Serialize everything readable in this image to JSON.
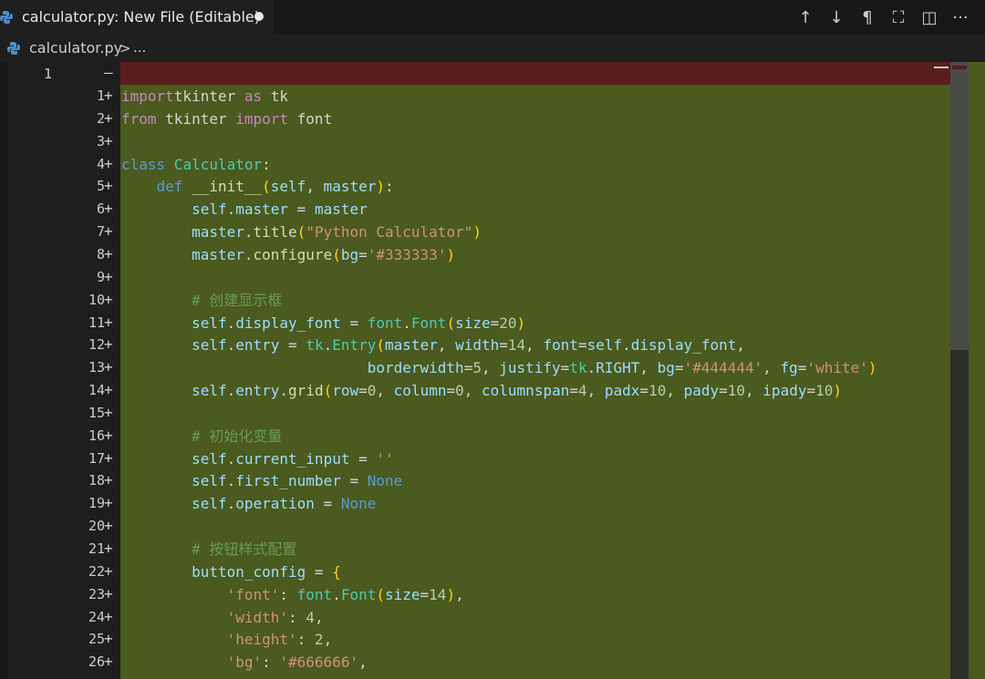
{
  "tab": {
    "title": "calculator.py: New File (Editable)",
    "python_icon": "python-icon",
    "modified_dot": "modified-dot-icon"
  },
  "actions": [
    {
      "name": "arrow-up-icon",
      "glyph": "↑"
    },
    {
      "name": "arrow-down-icon",
      "glyph": "↓"
    },
    {
      "name": "pilcrow-icon",
      "glyph": "¶"
    },
    {
      "name": "map-icon",
      "glyph": "⛶"
    },
    {
      "name": "split-editor-icon",
      "glyph": "◫"
    },
    {
      "name": "more-icon",
      "glyph": "···"
    }
  ],
  "breadcrumb": {
    "file": "calculator.py",
    "separator": ">",
    "more": "..."
  },
  "diff": {
    "original_line_number": "1",
    "original_marker": "—",
    "added_marker": "+"
  },
  "code": [
    {
      "num": "1",
      "segments": [
        [
          "kw",
          "import"
        ],
        [
          "",
          "tkinter"
        ],
        [
          "kw",
          " as"
        ],
        [
          "",
          " tk"
        ]
      ]
    },
    {
      "num": "2",
      "segments": [
        [
          "kw",
          "from"
        ],
        [
          "",
          " tkinter "
        ],
        [
          "kw",
          "import"
        ],
        [
          "",
          " font"
        ]
      ]
    },
    {
      "num": "3",
      "segments": []
    },
    {
      "num": "4",
      "segments": [
        [
          "def",
          "class"
        ],
        [
          "cls",
          " Calculator"
        ],
        [
          "",
          ":"
        ]
      ]
    },
    {
      "num": "5",
      "segments": [
        [
          "",
          "    "
        ],
        [
          "def",
          "def"
        ],
        [
          "fn",
          " __init__"
        ],
        [
          "brace",
          "("
        ],
        [
          "var",
          "self"
        ],
        [
          "",
          ", "
        ],
        [
          "var",
          "master"
        ],
        [
          "brace",
          ")"
        ],
        [
          "",
          ":"
        ]
      ]
    },
    {
      "num": "6",
      "segments": [
        [
          "",
          "        "
        ],
        [
          "var",
          "self"
        ],
        [
          "",
          "."
        ],
        [
          "var",
          "master"
        ],
        [
          "",
          " = "
        ],
        [
          "var",
          "master"
        ]
      ]
    },
    {
      "num": "7",
      "segments": [
        [
          "",
          "        "
        ],
        [
          "var",
          "master"
        ],
        [
          "",
          "."
        ],
        [
          "fn",
          "title"
        ],
        [
          "brace",
          "("
        ],
        [
          "str",
          "\"Python Calculator\""
        ],
        [
          "brace",
          ")"
        ]
      ]
    },
    {
      "num": "8",
      "segments": [
        [
          "",
          "        "
        ],
        [
          "var",
          "master"
        ],
        [
          "",
          "."
        ],
        [
          "fn",
          "configure"
        ],
        [
          "brace",
          "("
        ],
        [
          "var",
          "bg"
        ],
        [
          "",
          "="
        ],
        [
          "str",
          "'#333333'"
        ],
        [
          "brace",
          ")"
        ]
      ]
    },
    {
      "num": "9",
      "segments": []
    },
    {
      "num": "10",
      "segments": [
        [
          "",
          "        "
        ],
        [
          "cmt",
          "# 创建显示框"
        ]
      ]
    },
    {
      "num": "11",
      "segments": [
        [
          "",
          "        "
        ],
        [
          "var",
          "self"
        ],
        [
          "",
          "."
        ],
        [
          "var",
          "display_font"
        ],
        [
          "",
          " = "
        ],
        [
          "cls",
          "font"
        ],
        [
          "",
          "."
        ],
        [
          "cls",
          "Font"
        ],
        [
          "brace",
          "("
        ],
        [
          "var",
          "size"
        ],
        [
          "",
          "="
        ],
        [
          "num",
          "20"
        ],
        [
          "brace",
          ")"
        ]
      ]
    },
    {
      "num": "12",
      "segments": [
        [
          "",
          "        "
        ],
        [
          "var",
          "self"
        ],
        [
          "",
          "."
        ],
        [
          "var",
          "entry"
        ],
        [
          "",
          " = "
        ],
        [
          "cls",
          "tk"
        ],
        [
          "",
          "."
        ],
        [
          "cls",
          "Entry"
        ],
        [
          "brace",
          "("
        ],
        [
          "var",
          "master"
        ],
        [
          "",
          ", "
        ],
        [
          "var",
          "width"
        ],
        [
          "",
          "="
        ],
        [
          "num",
          "14"
        ],
        [
          "",
          ", "
        ],
        [
          "var",
          "font"
        ],
        [
          "",
          "="
        ],
        [
          "var",
          "self"
        ],
        [
          "",
          "."
        ],
        [
          "var",
          "display_font"
        ],
        [
          "",
          ","
        ]
      ]
    },
    {
      "num": "13",
      "segments": [
        [
          "",
          "                            "
        ],
        [
          "var",
          "borderwidth"
        ],
        [
          "",
          "="
        ],
        [
          "num",
          "5"
        ],
        [
          "",
          ", "
        ],
        [
          "var",
          "justify"
        ],
        [
          "",
          "="
        ],
        [
          "cls",
          "tk"
        ],
        [
          "",
          "."
        ],
        [
          "var",
          "RIGHT"
        ],
        [
          "",
          ", "
        ],
        [
          "var",
          "bg"
        ],
        [
          "",
          "="
        ],
        [
          "str",
          "'#444444'"
        ],
        [
          "",
          ", "
        ],
        [
          "var",
          "fg"
        ],
        [
          "",
          "="
        ],
        [
          "str",
          "'white'"
        ],
        [
          "brace",
          ")"
        ]
      ]
    },
    {
      "num": "14",
      "segments": [
        [
          "",
          "        "
        ],
        [
          "var",
          "self"
        ],
        [
          "",
          "."
        ],
        [
          "var",
          "entry"
        ],
        [
          "",
          "."
        ],
        [
          "fn",
          "grid"
        ],
        [
          "brace",
          "("
        ],
        [
          "var",
          "row"
        ],
        [
          "",
          "="
        ],
        [
          "num",
          "0"
        ],
        [
          "",
          ", "
        ],
        [
          "var",
          "column"
        ],
        [
          "",
          "="
        ],
        [
          "num",
          "0"
        ],
        [
          "",
          ", "
        ],
        [
          "var",
          "columnspan"
        ],
        [
          "",
          "="
        ],
        [
          "num",
          "4"
        ],
        [
          "",
          ", "
        ],
        [
          "var",
          "padx"
        ],
        [
          "",
          "="
        ],
        [
          "num",
          "10"
        ],
        [
          "",
          ", "
        ],
        [
          "var",
          "pady"
        ],
        [
          "",
          "="
        ],
        [
          "num",
          "10"
        ],
        [
          "",
          ", "
        ],
        [
          "var",
          "ipady"
        ],
        [
          "",
          "="
        ],
        [
          "num",
          "10"
        ],
        [
          "brace",
          ")"
        ]
      ]
    },
    {
      "num": "15",
      "segments": []
    },
    {
      "num": "16",
      "segments": [
        [
          "",
          "        "
        ],
        [
          "cmt",
          "# 初始化变量"
        ]
      ]
    },
    {
      "num": "17",
      "segments": [
        [
          "",
          "        "
        ],
        [
          "var",
          "self"
        ],
        [
          "",
          "."
        ],
        [
          "var",
          "current_input"
        ],
        [
          "",
          " = "
        ],
        [
          "str",
          "''"
        ]
      ]
    },
    {
      "num": "18",
      "segments": [
        [
          "",
          "        "
        ],
        [
          "var",
          "self"
        ],
        [
          "",
          "."
        ],
        [
          "var",
          "first_number"
        ],
        [
          "",
          " = "
        ],
        [
          "def",
          "None"
        ]
      ]
    },
    {
      "num": "19",
      "segments": [
        [
          "",
          "        "
        ],
        [
          "var",
          "self"
        ],
        [
          "",
          "."
        ],
        [
          "var",
          "operation"
        ],
        [
          "",
          " = "
        ],
        [
          "def",
          "None"
        ]
      ]
    },
    {
      "num": "20",
      "segments": []
    },
    {
      "num": "21",
      "segments": [
        [
          "",
          "        "
        ],
        [
          "cmt",
          "# 按钮样式配置"
        ]
      ]
    },
    {
      "num": "22",
      "segments": [
        [
          "",
          "        "
        ],
        [
          "var",
          "button_config"
        ],
        [
          "",
          " = "
        ],
        [
          "brace",
          "{"
        ]
      ]
    },
    {
      "num": "23",
      "segments": [
        [
          "",
          "            "
        ],
        [
          "str",
          "'font'"
        ],
        [
          "",
          ": "
        ],
        [
          "cls",
          "font"
        ],
        [
          "",
          "."
        ],
        [
          "cls",
          "Font"
        ],
        [
          "brace",
          "("
        ],
        [
          "var",
          "size"
        ],
        [
          "",
          "="
        ],
        [
          "num",
          "14"
        ],
        [
          "brace",
          ")"
        ],
        [
          "",
          ","
        ]
      ]
    },
    {
      "num": "24",
      "segments": [
        [
          "",
          "            "
        ],
        [
          "str",
          "'width'"
        ],
        [
          "",
          ": "
        ],
        [
          "num",
          "4"
        ],
        [
          "",
          ","
        ]
      ]
    },
    {
      "num": "25",
      "segments": [
        [
          "",
          "            "
        ],
        [
          "str",
          "'height'"
        ],
        [
          "",
          ": "
        ],
        [
          "num",
          "2"
        ],
        [
          "",
          ","
        ]
      ]
    },
    {
      "num": "26",
      "segments": [
        [
          "",
          "            "
        ],
        [
          "str",
          "'bg'"
        ],
        [
          "",
          ": "
        ],
        [
          "str",
          "'#666666'"
        ],
        [
          "",
          ","
        ]
      ]
    }
  ],
  "colors": {
    "added_bg": "#4b5a1e",
    "deleted_bg": "#5a1d1d",
    "editor_bg": "#1e1e1e"
  }
}
